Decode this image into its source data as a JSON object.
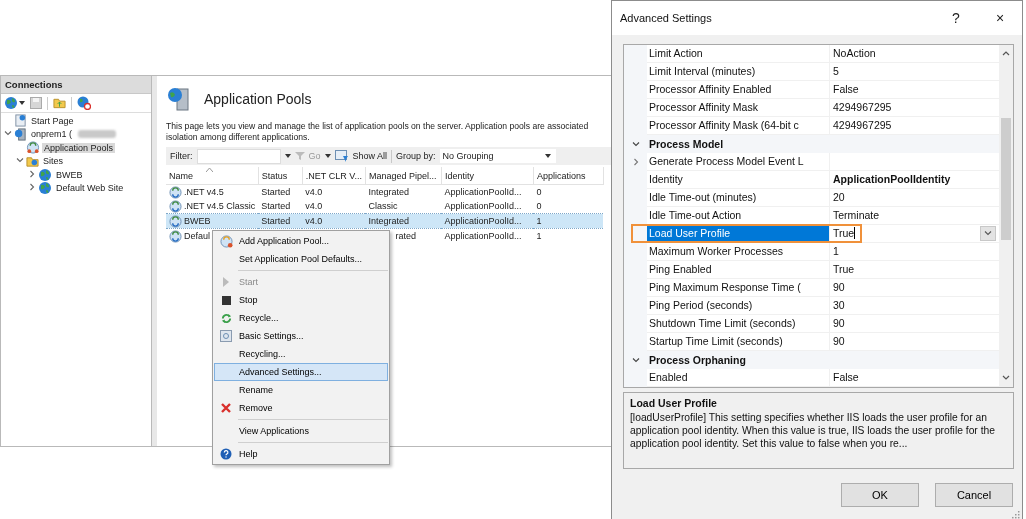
{
  "connections": {
    "title": "Connections",
    "tree": [
      {
        "kind": "start-page",
        "label": "Start Page",
        "selected": false
      },
      {
        "kind": "server",
        "label": "onprem1 (",
        "selected": false,
        "redacted": true,
        "expanded": true,
        "children": [
          {
            "kind": "app-pools",
            "label": "Application Pools",
            "selected": true
          },
          {
            "kind": "sites",
            "label": "Sites",
            "selected": false,
            "expanded": true,
            "children": [
              {
                "kind": "site",
                "label": "BWEB",
                "selected": false,
                "expanded": false
              },
              {
                "kind": "site",
                "label": "Default Web Site",
                "selected": false,
                "expanded": false
              }
            ]
          }
        ]
      }
    ]
  },
  "main": {
    "title": "Application Pools",
    "description_lines": [
      "This page lets you view and manage the list of application pools on the server. Application pools are associated",
      "isolation among different applications."
    ],
    "filter": {
      "label": "Filter:",
      "go": "Go",
      "go_disabled": true,
      "show_all": "Show All",
      "group_by_label": "Group by:",
      "group_by_value": "No Grouping"
    },
    "table": {
      "columns": [
        "Name",
        "Status",
        ".NET CLR V...",
        "Managed Pipel...",
        "Identity",
        "Applications"
      ],
      "rows": [
        {
          "cells": [
            ".NET v4.5",
            "Started",
            "v4.0",
            "Integrated",
            "ApplicationPoolId...",
            "0"
          ],
          "selected": false,
          "covered": false
        },
        {
          "cells": [
            ".NET v4.5 Classic",
            "Started",
            "v4.0",
            "Classic",
            "ApplicationPoolId...",
            "0"
          ],
          "selected": false,
          "covered": false
        },
        {
          "cells": [
            "BWEB",
            "Started",
            "v4.0",
            "Integrated",
            "ApplicationPoolId...",
            "1"
          ],
          "selected": true,
          "covered": false
        },
        {
          "cells": [
            "Defaul",
            null,
            null,
            "rated",
            "ApplicationPoolId...",
            "1"
          ],
          "selected": false,
          "covered": true
        }
      ]
    }
  },
  "context_menu": [
    {
      "kind": "item",
      "label": "Add Application Pool...",
      "disabled": false,
      "selected": false
    },
    {
      "kind": "item",
      "label": "Set Application Pool Defaults...",
      "disabled": false,
      "selected": false
    },
    {
      "kind": "separator"
    },
    {
      "kind": "item",
      "label": "Start",
      "disabled": true,
      "selected": false
    },
    {
      "kind": "item",
      "label": "Stop",
      "disabled": false,
      "selected": false
    },
    {
      "kind": "item",
      "label": "Recycle...",
      "disabled": false,
      "selected": false
    },
    {
      "kind": "item",
      "label": "Basic Settings...",
      "disabled": false,
      "selected": false
    },
    {
      "kind": "item",
      "label": "Recycling...",
      "disabled": false,
      "selected": false
    },
    {
      "kind": "item",
      "label": "Advanced Settings...",
      "disabled": false,
      "selected": true
    },
    {
      "kind": "item",
      "label": "Rename",
      "disabled": false,
      "selected": false
    },
    {
      "kind": "item",
      "label": "Remove",
      "disabled": false,
      "selected": false
    },
    {
      "kind": "separator"
    },
    {
      "kind": "item",
      "label": "View Applications",
      "disabled": false,
      "selected": false
    },
    {
      "kind": "separator"
    },
    {
      "kind": "item",
      "label": "Help",
      "disabled": false,
      "selected": false
    }
  ],
  "dialog": {
    "title": "Advanced Settings",
    "help": "?",
    "close": "×",
    "grid": [
      {
        "kind": "property",
        "name": "Limit Action",
        "value": "NoAction",
        "modified": false,
        "selected": false
      },
      {
        "kind": "property",
        "name": "Limit Interval (minutes)",
        "value": "5",
        "modified": false,
        "selected": false
      },
      {
        "kind": "property",
        "name": "Processor Affinity Enabled",
        "value": "False",
        "modified": false,
        "selected": false
      },
      {
        "kind": "property",
        "name": "Processor Affinity Mask",
        "value": "4294967295",
        "modified": false,
        "selected": false
      },
      {
        "kind": "property",
        "name": "Processor Affinity Mask (64-bit c",
        "value": "4294967295",
        "modified": false,
        "selected": false
      },
      {
        "kind": "category",
        "name": "Process Model",
        "expanded": true
      },
      {
        "kind": "property",
        "name": "Generate Process Model Event L",
        "expanded": false,
        "modified": false,
        "selected": false
      },
      {
        "kind": "property",
        "name": "Identity",
        "value": "ApplicationPoolIdentity",
        "modified": true,
        "selected": false
      },
      {
        "kind": "property",
        "name": "Idle Time-out (minutes)",
        "value": "20",
        "modified": false,
        "selected": false
      },
      {
        "kind": "property",
        "name": "Idle Time-out Action",
        "value": "Terminate",
        "modified": false,
        "selected": false
      },
      {
        "kind": "property",
        "name": "Load User Profile",
        "value": "True",
        "modified": false,
        "selected": true
      },
      {
        "kind": "property",
        "name": "Maximum Worker Processes",
        "value": "1",
        "modified": false,
        "selected": false
      },
      {
        "kind": "property",
        "name": "Ping Enabled",
        "value": "True",
        "modified": false,
        "selected": false
      },
      {
        "kind": "property",
        "name": "Ping Maximum Response Time (",
        "value": "90",
        "modified": false,
        "selected": false
      },
      {
        "kind": "property",
        "name": "Ping Period (seconds)",
        "value": "30",
        "modified": false,
        "selected": false
      },
      {
        "kind": "property",
        "name": "Shutdown Time Limit (seconds)",
        "value": "90",
        "modified": false,
        "selected": false
      },
      {
        "kind": "property",
        "name": "Startup Time Limit (seconds)",
        "value": "90",
        "modified": false,
        "selected": false
      },
      {
        "kind": "category",
        "name": "Process Orphaning",
        "expanded": true
      },
      {
        "kind": "property",
        "name": "Enabled",
        "value": "False",
        "modified": false,
        "selected": false
      }
    ],
    "description": {
      "title": "Load User Profile",
      "text": "[loadUserProfile] This setting specifies whether IIS loads the user profile for an application pool identity. When this value is true, IIS loads the user profile for the application pool identity. Set this value to false when you re..."
    },
    "buttons": [
      "OK",
      "Cancel"
    ]
  }
}
